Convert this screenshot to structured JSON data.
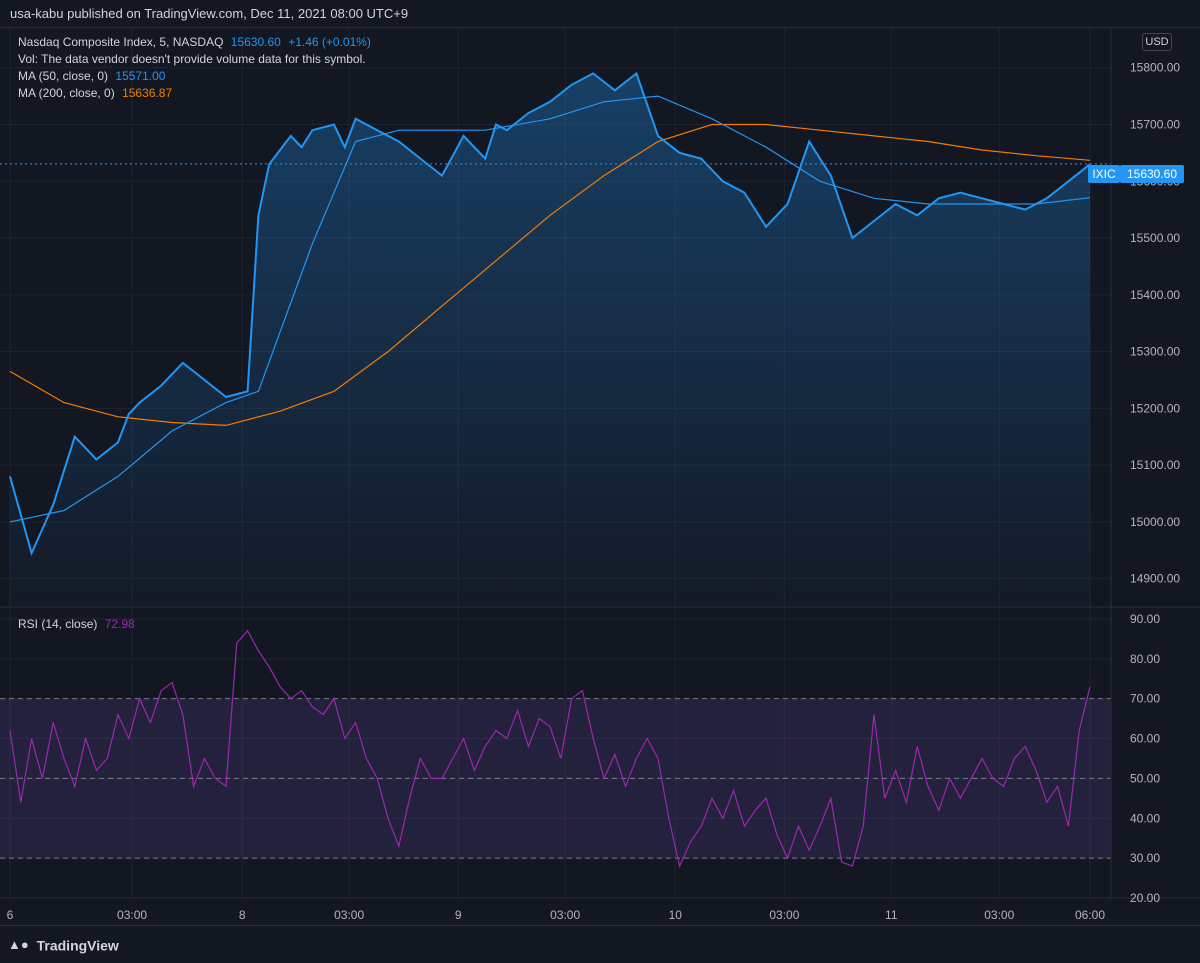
{
  "header": {
    "published": "usa-kabu published on TradingView.com, Dec 11, 2021 08:00 UTC+9"
  },
  "legend": {
    "symbol": "Nasdaq Composite Index, 5, NASDAQ",
    "price": "15630.60",
    "change": "+1.46 (+0.01%)",
    "vol_note": "Vol: The data vendor doesn't provide volume data for this symbol.",
    "ma50_label": "MA (50, close, 0)",
    "ma50_value": "15571.00",
    "ma200_label": "MA (200, close, 0)",
    "ma200_value": "15636.87",
    "rsi_label": "RSI (14, close)",
    "rsi_value": "72.98"
  },
  "currency_button": "USD",
  "price_tag": {
    "symbol": "IXIC",
    "value": "15630.60"
  },
  "footer": {
    "brand": "TradingView"
  },
  "colors": {
    "price_line": "#2196f3",
    "ma50": "#2196f3",
    "ma200": "#f57c00",
    "rsi": "#9c27b0",
    "background": "#131722"
  },
  "chart_data": {
    "type": "area",
    "x_ticks": [
      "6",
      "03:00",
      "8",
      "03:00",
      "9",
      "03:00",
      "10",
      "03:00",
      "11",
      "03:00",
      "06:00"
    ],
    "price_axis": {
      "ylim": [
        14850,
        15870
      ],
      "ticks": [
        "15800.00",
        "15700.00",
        "15600.00",
        "15500.00",
        "15400.00",
        "15300.00",
        "15200.00",
        "15100.00",
        "15000.00",
        "14900.00"
      ]
    },
    "rsi_axis": {
      "ylim": [
        20,
        93
      ],
      "ticks": [
        "90.00",
        "80.00",
        "70.00",
        "60.00",
        "50.00",
        "40.00",
        "30.00",
        "20.00"
      ],
      "bands": [
        30,
        50,
        70
      ]
    },
    "series": [
      {
        "name": "Nasdaq Composite Index",
        "x": [
          0,
          2,
          4,
          6,
          8,
          10,
          11,
          12,
          14,
          16,
          18,
          20,
          22,
          23,
          24,
          26,
          27,
          28,
          30,
          31,
          32,
          34,
          36,
          38,
          40,
          42,
          44,
          45,
          46,
          48,
          50,
          52,
          54,
          56,
          58,
          60,
          62,
          64,
          66,
          68,
          70,
          72,
          74,
          76,
          78,
          80,
          82,
          84,
          86,
          88,
          90,
          92,
          94,
          96,
          98,
          100
        ],
        "values": [
          15080,
          14945,
          15030,
          15150,
          15110,
          15140,
          15190,
          15210,
          15240,
          15280,
          15250,
          15220,
          15230,
          15540,
          15630,
          15680,
          15660,
          15690,
          15700,
          15660,
          15710,
          15690,
          15670,
          15640,
          15610,
          15680,
          15640,
          15700,
          15690,
          15720,
          15740,
          15770,
          15790,
          15760,
          15790,
          15680,
          15650,
          15640,
          15600,
          15580,
          15520,
          15560,
          15670,
          15610,
          15500,
          15530,
          15560,
          15540,
          15570,
          15580,
          15570,
          15560,
          15550,
          15570,
          15600,
          15630
        ]
      },
      {
        "name": "MA (50, close, 0)",
        "x": [
          0,
          5,
          10,
          15,
          20,
          23,
          28,
          32,
          36,
          40,
          44,
          50,
          55,
          60,
          65,
          70,
          75,
          80,
          85,
          90,
          95,
          100
        ],
        "values": [
          15000,
          15020,
          15080,
          15160,
          15210,
          15230,
          15490,
          15670,
          15690,
          15690,
          15690,
          15710,
          15740,
          15750,
          15710,
          15660,
          15600,
          15570,
          15560,
          15560,
          15560,
          15571
        ]
      },
      {
        "name": "MA (200, close, 0)",
        "x": [
          0,
          5,
          10,
          15,
          20,
          25,
          30,
          35,
          40,
          45,
          50,
          55,
          60,
          65,
          70,
          75,
          80,
          85,
          90,
          95,
          100
        ],
        "values": [
          15265,
          15210,
          15185,
          15175,
          15170,
          15195,
          15230,
          15300,
          15380,
          15460,
          15540,
          15610,
          15670,
          15700,
          15700,
          15690,
          15680,
          15670,
          15655,
          15645,
          15637
        ]
      },
      {
        "name": "RSI (14, close)",
        "x": [
          0,
          1,
          2,
          3,
          4,
          5,
          6,
          7,
          8,
          9,
          10,
          11,
          12,
          13,
          14,
          15,
          16,
          17,
          18,
          19,
          20,
          21,
          22,
          23,
          24,
          25,
          26,
          27,
          28,
          29,
          30,
          31,
          32,
          33,
          34,
          35,
          36,
          37,
          38,
          39,
          40,
          41,
          42,
          43,
          44,
          45,
          46,
          47,
          48,
          49,
          50,
          51,
          52,
          53,
          54,
          55,
          56,
          57,
          58,
          59,
          60,
          61,
          62,
          63,
          64,
          65,
          66,
          67,
          68,
          69,
          70,
          71,
          72,
          73,
          74,
          75,
          76,
          77,
          78,
          79,
          80,
          81,
          82,
          83,
          84,
          85,
          86,
          87,
          88,
          89,
          90,
          91,
          92,
          93,
          94,
          95,
          96,
          97,
          98,
          99,
          100
        ],
        "values": [
          62,
          44,
          60,
          50,
          64,
          55,
          48,
          60,
          52,
          55,
          66,
          60,
          70,
          64,
          72,
          74,
          66,
          48,
          55,
          50,
          48,
          84,
          87,
          82,
          78,
          73,
          70,
          72,
          68,
          66,
          70,
          60,
          64,
          55,
          50,
          40,
          33,
          45,
          55,
          50,
          50,
          55,
          60,
          52,
          58,
          62,
          60,
          67,
          58,
          65,
          63,
          55,
          70,
          72,
          60,
          50,
          56,
          48,
          55,
          60,
          55,
          40,
          28,
          34,
          38,
          45,
          40,
          47,
          38,
          42,
          45,
          36,
          30,
          38,
          32,
          38,
          45,
          29,
          28,
          38,
          66,
          45,
          52,
          44,
          58,
          48,
          42,
          50,
          45,
          50,
          55,
          50,
          48,
          55,
          58,
          52,
          44,
          48,
          38,
          62,
          73
        ]
      }
    ]
  }
}
